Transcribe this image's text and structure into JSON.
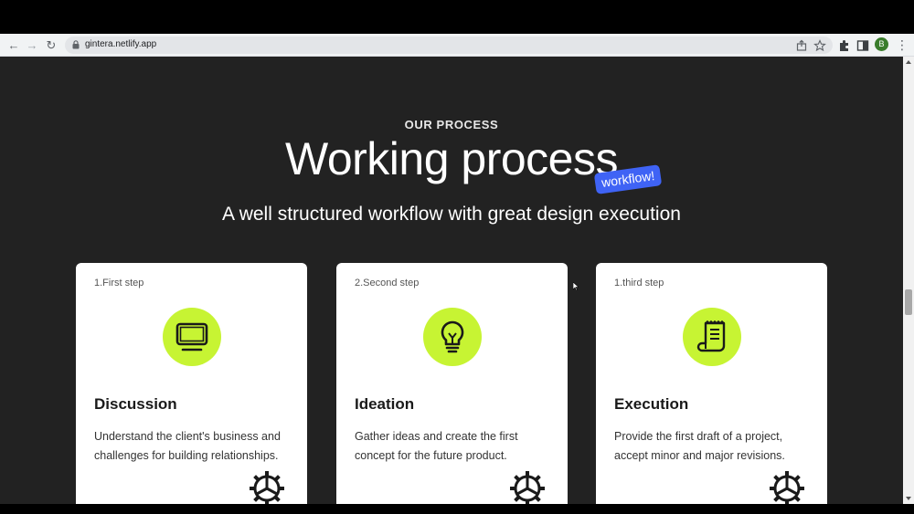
{
  "browser": {
    "url": "gintera.netlify.app",
    "avatar_letter": "B"
  },
  "section": {
    "eyebrow": "OUR PROCESS",
    "title": "Working process",
    "tag": "workflow!",
    "subtitle": "A well structured workflow with great design execution"
  },
  "cards": [
    {
      "step": "1.First step",
      "title": "Discussion",
      "description": "Understand the client's business and challenges for building relationships.",
      "icon": "monitor-icon"
    },
    {
      "step": "2.Second step",
      "title": "Ideation",
      "description": "Gather ideas and create the first concept for the future product.",
      "icon": "lightbulb-icon"
    },
    {
      "step": "1.third step",
      "title": "Execution",
      "description": "Provide the first draft of a project, accept minor and major revisions.",
      "icon": "scroll-icon"
    }
  ],
  "colors": {
    "page_background": "#222222",
    "accent_lime": "#c7f433",
    "tag_blue": "#3f63f5",
    "card_background": "#ffffff"
  }
}
